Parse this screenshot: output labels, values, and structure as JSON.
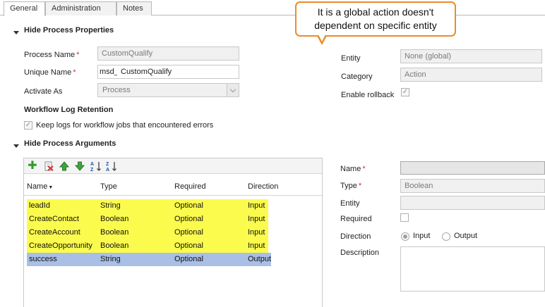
{
  "tabs": [
    {
      "label": "General"
    },
    {
      "label": "Administration"
    },
    {
      "label": "Notes"
    }
  ],
  "callout": {
    "line1": "It is a global action doesn't",
    "line2": "dependent on specific entity"
  },
  "process_properties": {
    "header": "Hide Process Properties",
    "process_name_label": "Process Name",
    "process_name_value": "CustomQualify",
    "unique_name_label": "Unique Name",
    "unique_name_prefix": "msd_",
    "unique_name_value": "CustomQualify",
    "activate_as_label": "Activate As",
    "activate_as_value": "Process",
    "log_retention_header": "Workflow Log Retention",
    "keep_logs_label": "Keep logs for workflow jobs that encountered errors",
    "keep_logs_checked": true,
    "entity_label": "Entity",
    "entity_value": "None (global)",
    "category_label": "Category",
    "category_value": "Action",
    "enable_rollback_label": "Enable rollback",
    "enable_rollback_checked": true
  },
  "process_arguments": {
    "header": "Hide Process Arguments",
    "toolbar": [
      {
        "icon": "add-icon"
      },
      {
        "icon": "delete-icon"
      },
      {
        "icon": "move-up-icon"
      },
      {
        "icon": "move-down-icon"
      },
      {
        "icon": "sort-ascending-icon",
        "text": "A↓Z"
      },
      {
        "icon": "sort-descending-icon",
        "text": "Z↓A"
      }
    ],
    "columns": {
      "name": "Name",
      "type": "Type",
      "required": "Required",
      "direction": "Direction"
    },
    "rows": [
      {
        "name": "leadId",
        "type": "String",
        "required": "Optional",
        "direction": "Input",
        "highlight": true
      },
      {
        "name": "CreateContact",
        "type": "Boolean",
        "required": "Optional",
        "direction": "Input",
        "highlight": true
      },
      {
        "name": "CreateAccount",
        "type": "Boolean",
        "required": "Optional",
        "direction": "Input",
        "highlight": true
      },
      {
        "name": "CreateOpportunity",
        "type": "Boolean",
        "required": "Optional",
        "direction": "Input",
        "highlight": true
      },
      {
        "name": "success",
        "type": "String",
        "required": "Optional",
        "direction": "Output",
        "selected": true
      }
    ]
  },
  "argument_details": {
    "name_label": "Name",
    "name_value": "",
    "type_label": "Type",
    "type_value": "Boolean",
    "entity_label": "Entity",
    "entity_value": "",
    "required_label": "Required",
    "required_checked": false,
    "direction_label": "Direction",
    "direction_input": "Input",
    "direction_output": "Output",
    "direction_selected": "Input",
    "description_label": "Description",
    "description_value": ""
  },
  "colors": {
    "highlight": "#fbfb4e",
    "selected": "#a9bfe6",
    "callout_border": "#e98d2b",
    "required_star": "#c0392b"
  }
}
